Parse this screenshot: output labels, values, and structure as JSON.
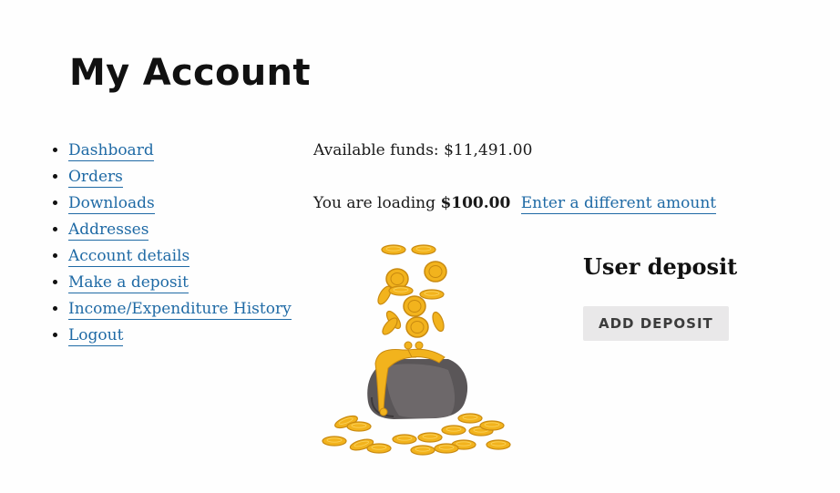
{
  "page": {
    "title": "My Account"
  },
  "nav": {
    "items": [
      {
        "label": "Dashboard"
      },
      {
        "label": "Orders"
      },
      {
        "label": "Downloads"
      },
      {
        "label": "Addresses"
      },
      {
        "label": "Account details"
      },
      {
        "label": "Make a deposit"
      },
      {
        "label": "Income/Expenditure History"
      },
      {
        "label": "Logout"
      }
    ]
  },
  "wallet": {
    "funds_label": "Available funds:",
    "funds_value": "$11,491.00",
    "loading_prefix": "You are loading",
    "loading_amount": "$100.00",
    "change_amount_link": "Enter a different amount"
  },
  "deposit": {
    "title": "User deposit",
    "button_label": "Add deposit"
  },
  "colors": {
    "link": "#1f6aa5",
    "coin": "#f2b31d",
    "coin_dark": "#c98a10",
    "purse": "#5a5658",
    "button_bg": "#e9e8e9"
  },
  "icons": {
    "illustration": "coin-purse-icon"
  }
}
